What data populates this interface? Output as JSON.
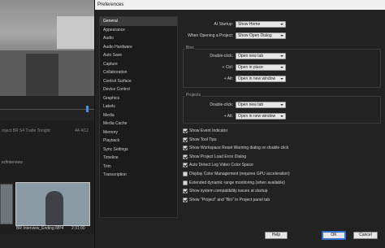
{
  "background": {
    "project_tab": "roject BR S4 Trade Tonight",
    "project_tab_count": "4A 4/12",
    "project_label": "er/Interview",
    "clip_name": "BR Interview_Ending.MP4",
    "clip_duration": "2:31:00"
  },
  "dialog": {
    "title": "Preferences",
    "categories": [
      "General",
      "Appearance",
      "Audio",
      "Audio Hardware",
      "Auto Save",
      "Capture",
      "Collaboration",
      "Control Surface",
      "Device Control",
      "Graphics",
      "Labels",
      "Media",
      "Media Cache",
      "Memory",
      "Playback",
      "Sync Settings",
      "Timeline",
      "Trim",
      "Transcription"
    ],
    "selected_category": "General",
    "general": {
      "at_startup_label": "At Startup:",
      "at_startup_value": "Show Home",
      "opening_project_label": "When Opening a Project:",
      "opening_project_value": "Show Open Dialog",
      "bins": {
        "title": "Bins",
        "double_click_label": "Double-click:",
        "double_click_value": "Open new tab",
        "ctrl_label": "+ Ctrl:",
        "ctrl_value": "Open in place",
        "alt_label": "+ Alt:",
        "alt_value": "Open in new window"
      },
      "projects": {
        "title": "Projects",
        "double_click_label": "Double-click:",
        "double_click_value": "Open new tab",
        "alt_label": "+ Alt:",
        "alt_value": "Open in new window"
      },
      "checkboxes": [
        {
          "label": "Show Event Indicator",
          "checked": true
        },
        {
          "label": "Show Tool Tips",
          "checked": true
        },
        {
          "label": "Show Workspace Reset Warning dialog on double click",
          "checked": true
        },
        {
          "label": "Show Project Load Error Dialog",
          "checked": true
        },
        {
          "label": "Auto Detect Log Video Color Space",
          "checked": true
        },
        {
          "label": "Display Color Management (requires GPU acceleration)",
          "checked": false
        },
        {
          "label": "Extended dynamic range monitoring (when available)",
          "checked": false
        },
        {
          "label": "Show system compatibility issues at startup",
          "checked": true
        },
        {
          "label": "Show \"Project\" and \"Bin\" in Project panel tab",
          "checked": true
        }
      ]
    },
    "buttons": {
      "help": "Help",
      "ok": "OK",
      "cancel": "Cancel"
    }
  }
}
